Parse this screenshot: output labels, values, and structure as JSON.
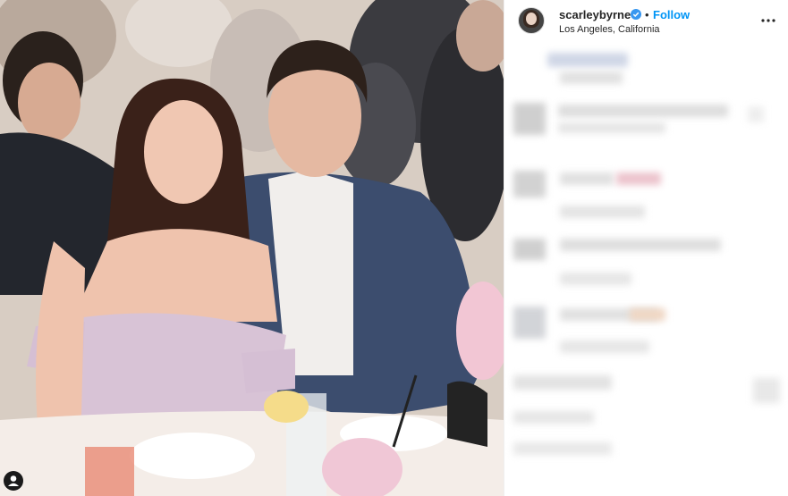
{
  "post": {
    "username": "scarleybyrne",
    "location": "Los Angeles, California",
    "follow_label": "Follow",
    "separator": "•",
    "verified": true,
    "avatar_icon": "profile-avatar",
    "more_icon": "more-options-icon",
    "tag_icon": "user-tag-icon"
  },
  "colors": {
    "accent": "#0095f6",
    "verified": "#3897f0",
    "text": "#262626"
  }
}
